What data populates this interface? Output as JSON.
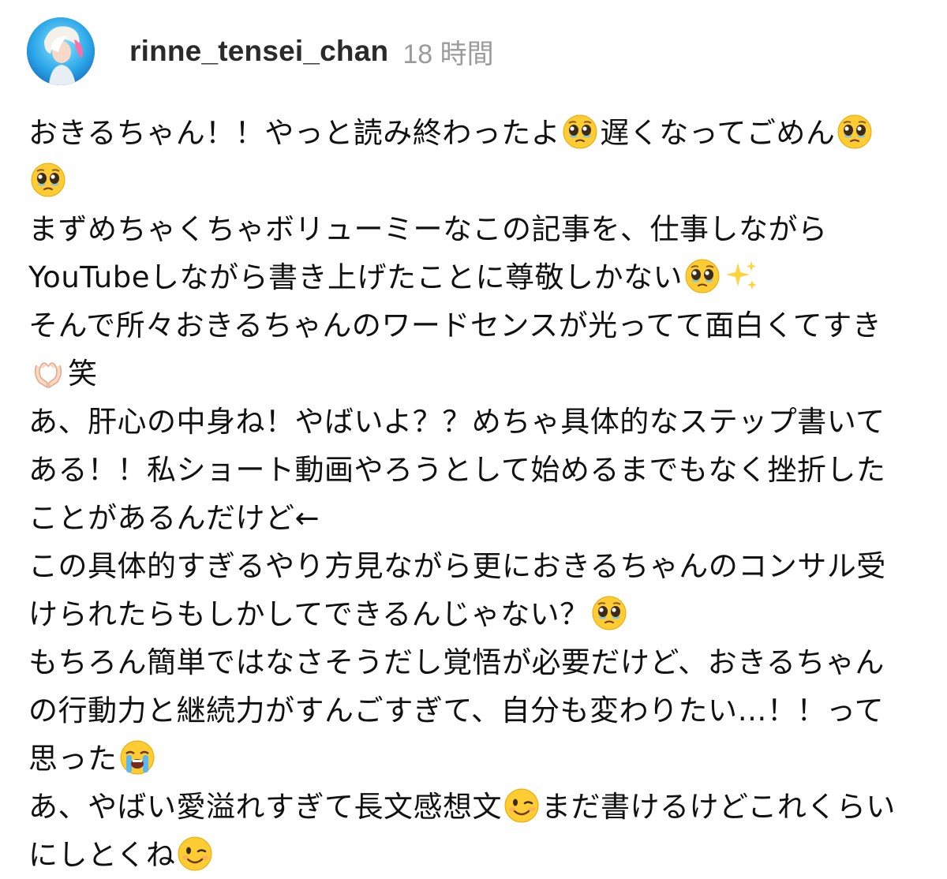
{
  "comment": {
    "username": "rinne_tensei_chan",
    "timestamp": "18 時間",
    "lines": [
      [
        "おきるちゃん！！やっと読み終わったよ",
        "pleading-face-emoji",
        "遅くなってごめん",
        "pleading-face-emoji"
      ],
      [
        "",
        "pleading-face-emoji",
        ""
      ],
      [
        "まずめちゃくちゃボリューミーなこの記事を、仕事しながら"
      ],
      [
        "YouTubeしながら書き上げたことに尊敬しかない",
        "pleading-face-emoji",
        "sparkles-emoji",
        ""
      ],
      [
        "そんで所々おきるちゃんのワードセンスが光ってて面白くてすき"
      ],
      [
        "",
        "heart-hands-emoji",
        "笑"
      ],
      [
        "あ、肝心の中身ね！やばいよ？？めちゃ具体的なステップ書いて"
      ],
      [
        "ある！！私ショート動画やろうとして始めるまでもなく挫折した"
      ],
      [
        "ことがあるんだけど←"
      ],
      [
        "この具体的すぎるやり方見ながら更におきるちゃんのコンサル受"
      ],
      [
        "けられたらもしかしてできるんじゃない？",
        "pleading-face-emoji"
      ],
      [
        "もちろん簡単ではなさそうだし覚悟が必要だけど、おきるちゃん"
      ],
      [
        "の行動力と継続力がすんごすぎて、自分も変わりたい…！！って"
      ],
      [
        "思った",
        "loudly-crying-face-emoji"
      ],
      [
        "あ、やばい愛溢れすぎて長文感想文",
        "winking-face-emoji",
        "まだ書けるけどこれくらい"
      ],
      [
        "にしとくね",
        "winking-face-emoji"
      ]
    ]
  }
}
